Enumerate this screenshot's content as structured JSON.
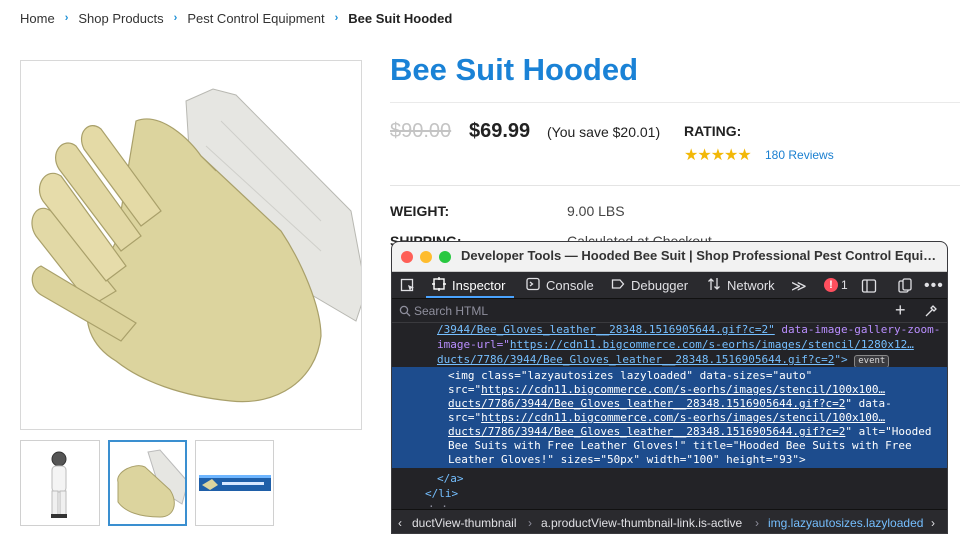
{
  "breadcrumb": {
    "items": [
      "Home",
      "Shop Products",
      "Pest Control Equipment"
    ],
    "current": "Bee Suit Hooded"
  },
  "product": {
    "title": "Bee Suit Hooded",
    "old_price": "$90.00",
    "price": "$69.99",
    "save_note": "(You save $20.01)",
    "rating_label": "RATING:",
    "stars": "★★★★★",
    "rating_value": 5,
    "reviews": "180 Reviews",
    "weight_label": "WEIGHT:",
    "weight_value": "9.00 LBS",
    "shipping_label": "SHIPPING:",
    "shipping_value": "Calculated at Checkout"
  },
  "thumbnails": [
    {
      "name": "bee-suit",
      "active": false
    },
    {
      "name": "leather-gloves",
      "active": true
    },
    {
      "name": "banner",
      "active": false
    }
  ],
  "devtools": {
    "window_title": "Developer Tools — Hooded Bee Suit | Shop Professional Pest Control Equi…",
    "tabs": {
      "inspector": "Inspector",
      "console": "Console",
      "debugger": "Debugger",
      "network": "Network",
      "more": "≫"
    },
    "error_count": "1",
    "search_placeholder": "Search HTML",
    "code": {
      "line1a": "/3944/Bee_Gloves_leather__28348.1516905644.gif?c=2\"",
      "line1b": " data-image-gallery-zoom-",
      "line2a": "image-url=\"",
      "line2b": "https://cdn11.bigcommerce.com/s-eorhs/images/stencil/1280x12…",
      "line3a": "ducts/7786/3944/Bee_Gloves_leather__28348.1516905644.gif?c=2",
      "line3b": "\">",
      "event": "event",
      "h1": "<img class=\"lazyautosizes lazyloaded\" data-sizes=\"auto\"",
      "h2a": "src=\"",
      "h2b": "https://cdn11.bigcommerce.com/s-eorhs/images/stencil/100x100…",
      "h3a": "ducts/7786/3944/Bee_Gloves_leather__28348.1516905644.gif?c=2",
      "h3b": "\" data-",
      "h4a": "src=\"",
      "h4b": "https://cdn11.bigcommerce.com/s-eorhs/images/stencil/100x100…",
      "h5a": "ducts/7786/3944/Bee_Gloves_leather__28348.1516905644.gif?c=2",
      "h5b": "\" alt=\"Hooded",
      "h6": "Bee Suits with Free Leather Gloves!\" title=\"Hooded Bee Suits with Free",
      "h7": "Leather Gloves!\" sizes=\"50px\" width=\"100\" height=\"93\">",
      "close_a": "</a>",
      "close_li": "</li>",
      "dots": "· ·"
    },
    "bottom_crumbs": {
      "c1": "ductView-thumbnail",
      "c2": "a.productView-thumbnail-link.is-active",
      "c3": "img.lazyautosizes.lazyloaded"
    }
  }
}
